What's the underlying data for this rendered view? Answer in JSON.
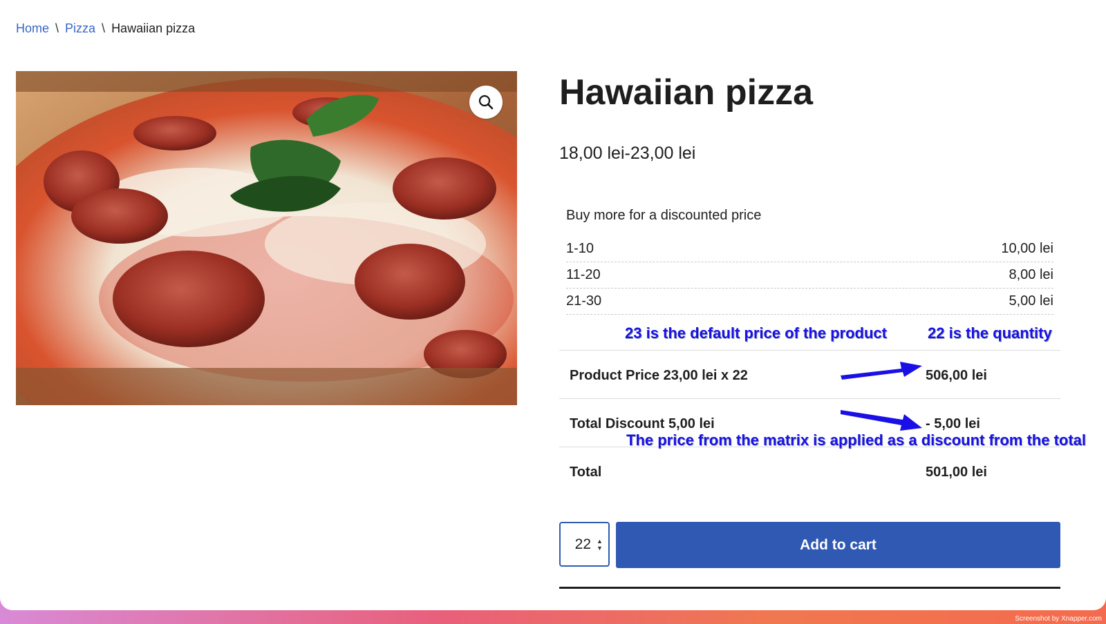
{
  "breadcrumb": {
    "home": "Home",
    "category": "Pizza",
    "separator": "\\",
    "current": "Hawaiian pizza"
  },
  "product": {
    "title": "Hawaiian pizza",
    "price_range": "18,00 lei-23,00 lei"
  },
  "matrix": {
    "label": "Buy more for a discounted price",
    "rows": [
      {
        "range": "1-10",
        "price": "10,00 lei"
      },
      {
        "range": "11-20",
        "price": "8,00 lei"
      },
      {
        "range": "21-30",
        "price": "5,00 lei"
      }
    ]
  },
  "totals": {
    "product_price_label": "Product Price 23,00 lei x 22",
    "product_price_value": "506,00 lei",
    "discount_label": "Total Discount 5,00 lei",
    "discount_value": "- 5,00 lei",
    "total_label": "Total",
    "total_value": "501,00 lei"
  },
  "annotations": {
    "default_price": "23 is the default price of the product",
    "quantity": "22 is the quantity",
    "discount_note": "The price from the matrix is applied as a discount from the total",
    "color": "#1a10e6"
  },
  "cart": {
    "quantity": "22",
    "button_label": "Add to cart"
  },
  "icons": {
    "zoom": "search-icon",
    "stepper_up": "caret-up-icon",
    "stepper_down": "caret-down-icon"
  },
  "colors": {
    "link": "#3a66c4",
    "button": "#3059b3"
  },
  "footer": {
    "credit": "Screenshot by Xnapper.com"
  }
}
